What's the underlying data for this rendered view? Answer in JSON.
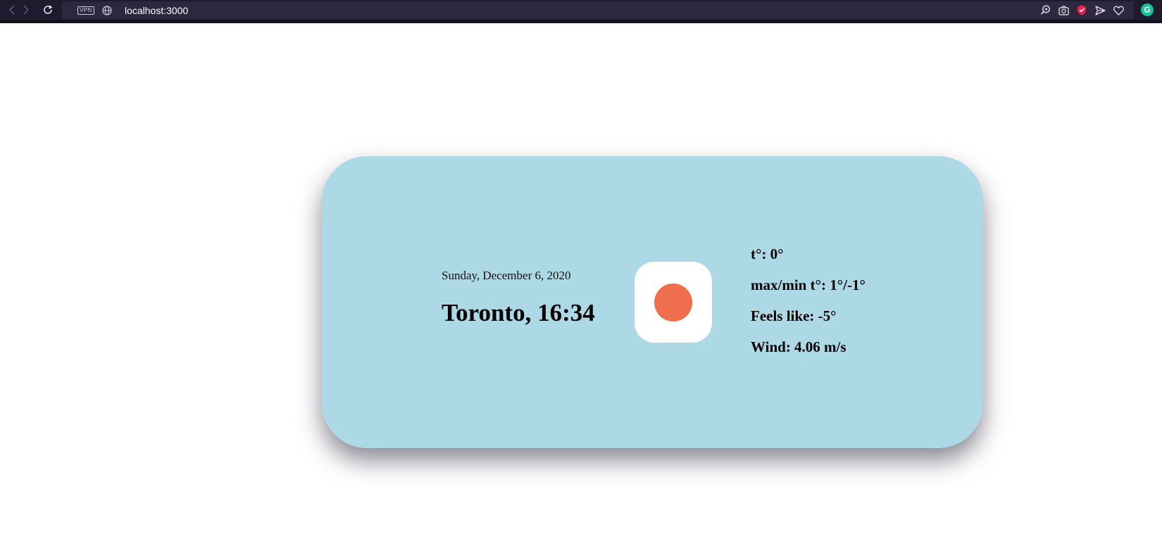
{
  "browser": {
    "url": "localhost:3000",
    "vpn_label": "VPN",
    "back_icon": "chevron-left-icon",
    "forward_icon": "chevron-right-icon",
    "reload_icon": "reload-icon",
    "toolbar_icons": [
      "zoom-icon",
      "camera-icon",
      "shield-icon",
      "send-icon",
      "heart-icon"
    ],
    "grammarly_label": "G",
    "colors": {
      "bar": "#1f1b2e",
      "address": "#2d2840",
      "shield": "#e8204e",
      "grammarly": "#15c39a"
    }
  },
  "weather": {
    "date": "Sunday, December 6, 2020",
    "city_time": "Toronto, 16:34",
    "icon": "sun-icon",
    "icon_color": "#ee6e4d",
    "card_color": "#add8e6",
    "temperature": "t°: 0°",
    "max_min": "max/min t°: 1°/-1°",
    "feels_like": "Feels like: -5°",
    "wind": "Wind: 4.06 m/s"
  }
}
